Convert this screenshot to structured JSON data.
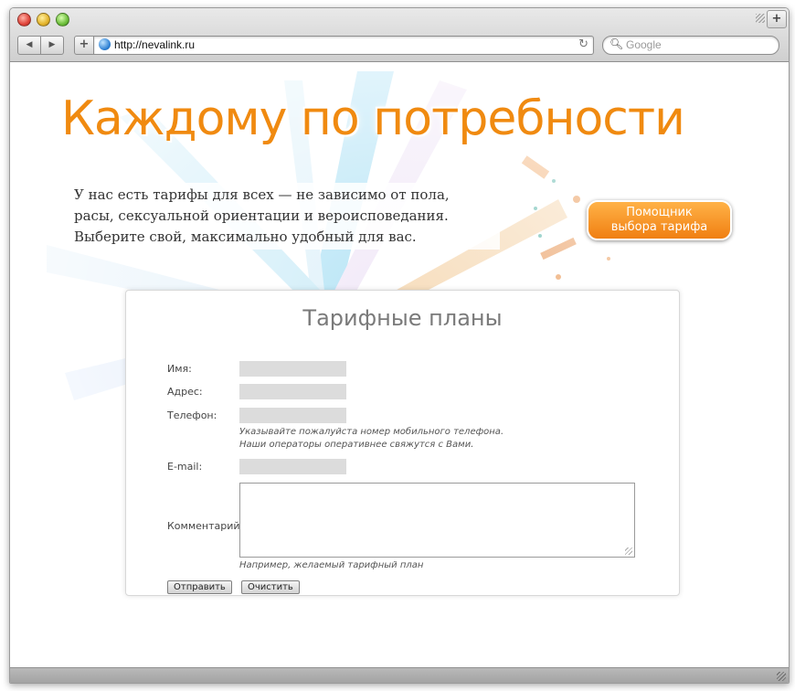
{
  "browser": {
    "url": "http://nevalink.ru",
    "search_placeholder": "Google"
  },
  "page": {
    "headline": "Каждому по потребности",
    "intro_lines": [
      "У нас есть тарифы для всех — не зависимо от пола,",
      "расы, сексуальной ориентации и вероисповедания.",
      "Выберите свой, максимально удобный для вас."
    ],
    "helper_button_lines": [
      "Помощник",
      "выбора тарифа"
    ]
  },
  "form": {
    "title": "Тарифные планы",
    "name_label": "Имя:",
    "address_label": "Адрес:",
    "phone_label": "Телефон:",
    "phone_hint_lines": [
      "Указывайте пожалуйста номер мобильного телефона.",
      "Наши операторы оперативнее свяжутся с Вами."
    ],
    "email_label": "E-mail:",
    "comment_label": "Комментарий:",
    "comment_hint": "Например, желаемый тарифный план",
    "submit_label": "Отправить",
    "reset_label": "Очистить"
  },
  "colors": {
    "accent_orange": "#f08a10",
    "field_gray": "#dcdcdc"
  }
}
